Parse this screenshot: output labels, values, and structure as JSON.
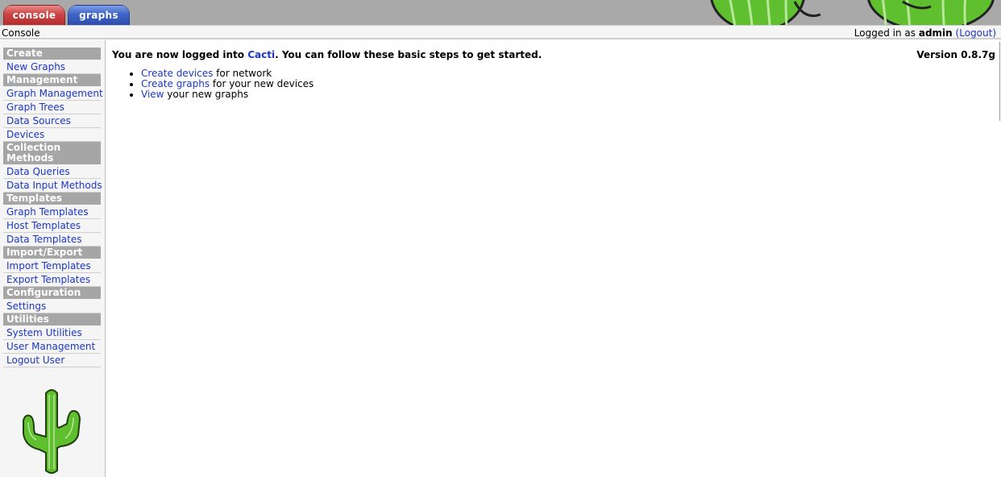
{
  "tabs": {
    "console": "console",
    "graphs": "graphs"
  },
  "breadcrumb": "Console",
  "login": {
    "prefix": "Logged in as ",
    "user": "admin",
    "logout": "Logout"
  },
  "sidebar": {
    "groups": [
      {
        "header": "Create",
        "items": [
          "New Graphs"
        ]
      },
      {
        "header": "Management",
        "items": [
          "Graph Management",
          "Graph Trees",
          "Data Sources",
          "Devices"
        ]
      },
      {
        "header": "Collection Methods",
        "items": [
          "Data Queries",
          "Data Input Methods"
        ]
      },
      {
        "header": "Templates",
        "items": [
          "Graph Templates",
          "Host Templates",
          "Data Templates"
        ]
      },
      {
        "header": "Import/Export",
        "items": [
          "Import Templates",
          "Export Templates"
        ]
      },
      {
        "header": "Configuration",
        "items": [
          "Settings"
        ]
      },
      {
        "header": "Utilities",
        "items": [
          "System Utilities",
          "User Management",
          "Logout User"
        ]
      }
    ]
  },
  "main": {
    "welcome_prefix": "You are now logged into ",
    "welcome_link": "Cacti",
    "welcome_suffix": ". You can follow these basic steps to get started.",
    "version": "Version 0.8.7g",
    "steps": [
      {
        "link": "Create devices",
        "text": " for network"
      },
      {
        "link": "Create graphs",
        "text": " for your new devices"
      },
      {
        "link": "View",
        "text": " your new graphs"
      }
    ]
  },
  "colors": {
    "tab_console": "#c94343",
    "tab_graphs": "#3f64c4",
    "link": "#1c37c6",
    "menu_header": "#a6a6a6",
    "cactus": "#5fbf2e"
  }
}
